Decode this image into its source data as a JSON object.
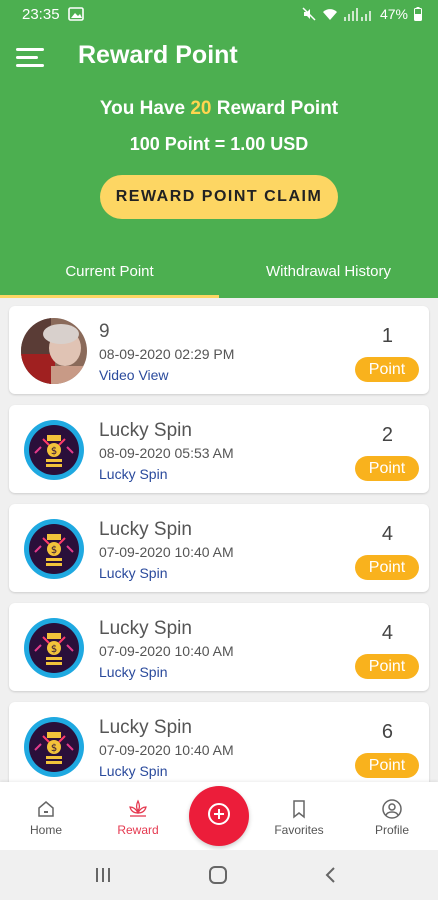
{
  "status_bar": {
    "time": "23:35",
    "battery": "47%"
  },
  "header": {
    "title": "Reward Point",
    "reward_prefix": "You Have ",
    "reward_count": "20",
    "reward_suffix": " Reward Point",
    "rate": "100 Point = 1.00 USD",
    "claim_button": "REWARD POINT CLAIM"
  },
  "tabs": [
    {
      "label": "Current Point",
      "active": true
    },
    {
      "label": "Withdrawal History",
      "active": false
    }
  ],
  "entries": [
    {
      "title": "9",
      "date": "08-09-2020 02:29 PM",
      "type": "Video View",
      "points": "1",
      "unit": "Point",
      "avatar": "video-thumbnail"
    },
    {
      "title": "Lucky Spin",
      "date": "08-09-2020 05:53 AM",
      "type": "Lucky Spin",
      "points": "2",
      "unit": "Point",
      "avatar": "lucky-spin-icon"
    },
    {
      "title": "Lucky Spin",
      "date": "07-09-2020 10:40 AM",
      "type": "Lucky Spin",
      "points": "4",
      "unit": "Point",
      "avatar": "lucky-spin-icon"
    },
    {
      "title": "Lucky Spin",
      "date": "07-09-2020 10:40 AM",
      "type": "Lucky Spin",
      "points": "4",
      "unit": "Point",
      "avatar": "lucky-spin-icon"
    },
    {
      "title": "Lucky Spin",
      "date": "07-09-2020 10:40 AM",
      "type": "Lucky Spin",
      "points": "6",
      "unit": "Point",
      "avatar": "lucky-spin-icon"
    }
  ],
  "bottom_nav": {
    "home": "Home",
    "reward": "Reward",
    "favorites": "Favorites",
    "profile": "Profile"
  },
  "colors": {
    "primary": "#4caf50",
    "accent": "#fdd663",
    "point_pill": "#f9b21d",
    "fab": "#ec1d3a",
    "active_nav": "#e53950"
  }
}
